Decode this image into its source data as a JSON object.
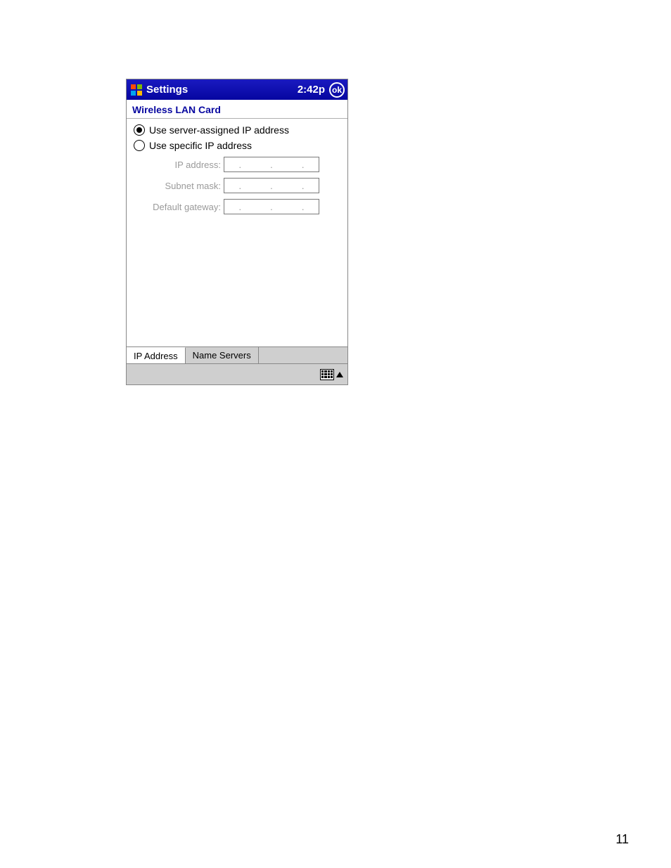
{
  "titlebar": {
    "title": "Settings",
    "time": "2:42p",
    "ok_label": "ok"
  },
  "subheader": {
    "title": "Wireless LAN Card"
  },
  "radios": {
    "server_assigned": "Use server-assigned IP address",
    "specific": "Use specific IP address"
  },
  "fields": {
    "ip_label": "IP address:",
    "subnet_label": "Subnet mask:",
    "gateway_label": "Default gateway:",
    "ip_value": "",
    "subnet_value": "",
    "gateway_value": ""
  },
  "tabs": {
    "ip": "IP Address",
    "ns": "Name Servers"
  },
  "page_number": "11"
}
